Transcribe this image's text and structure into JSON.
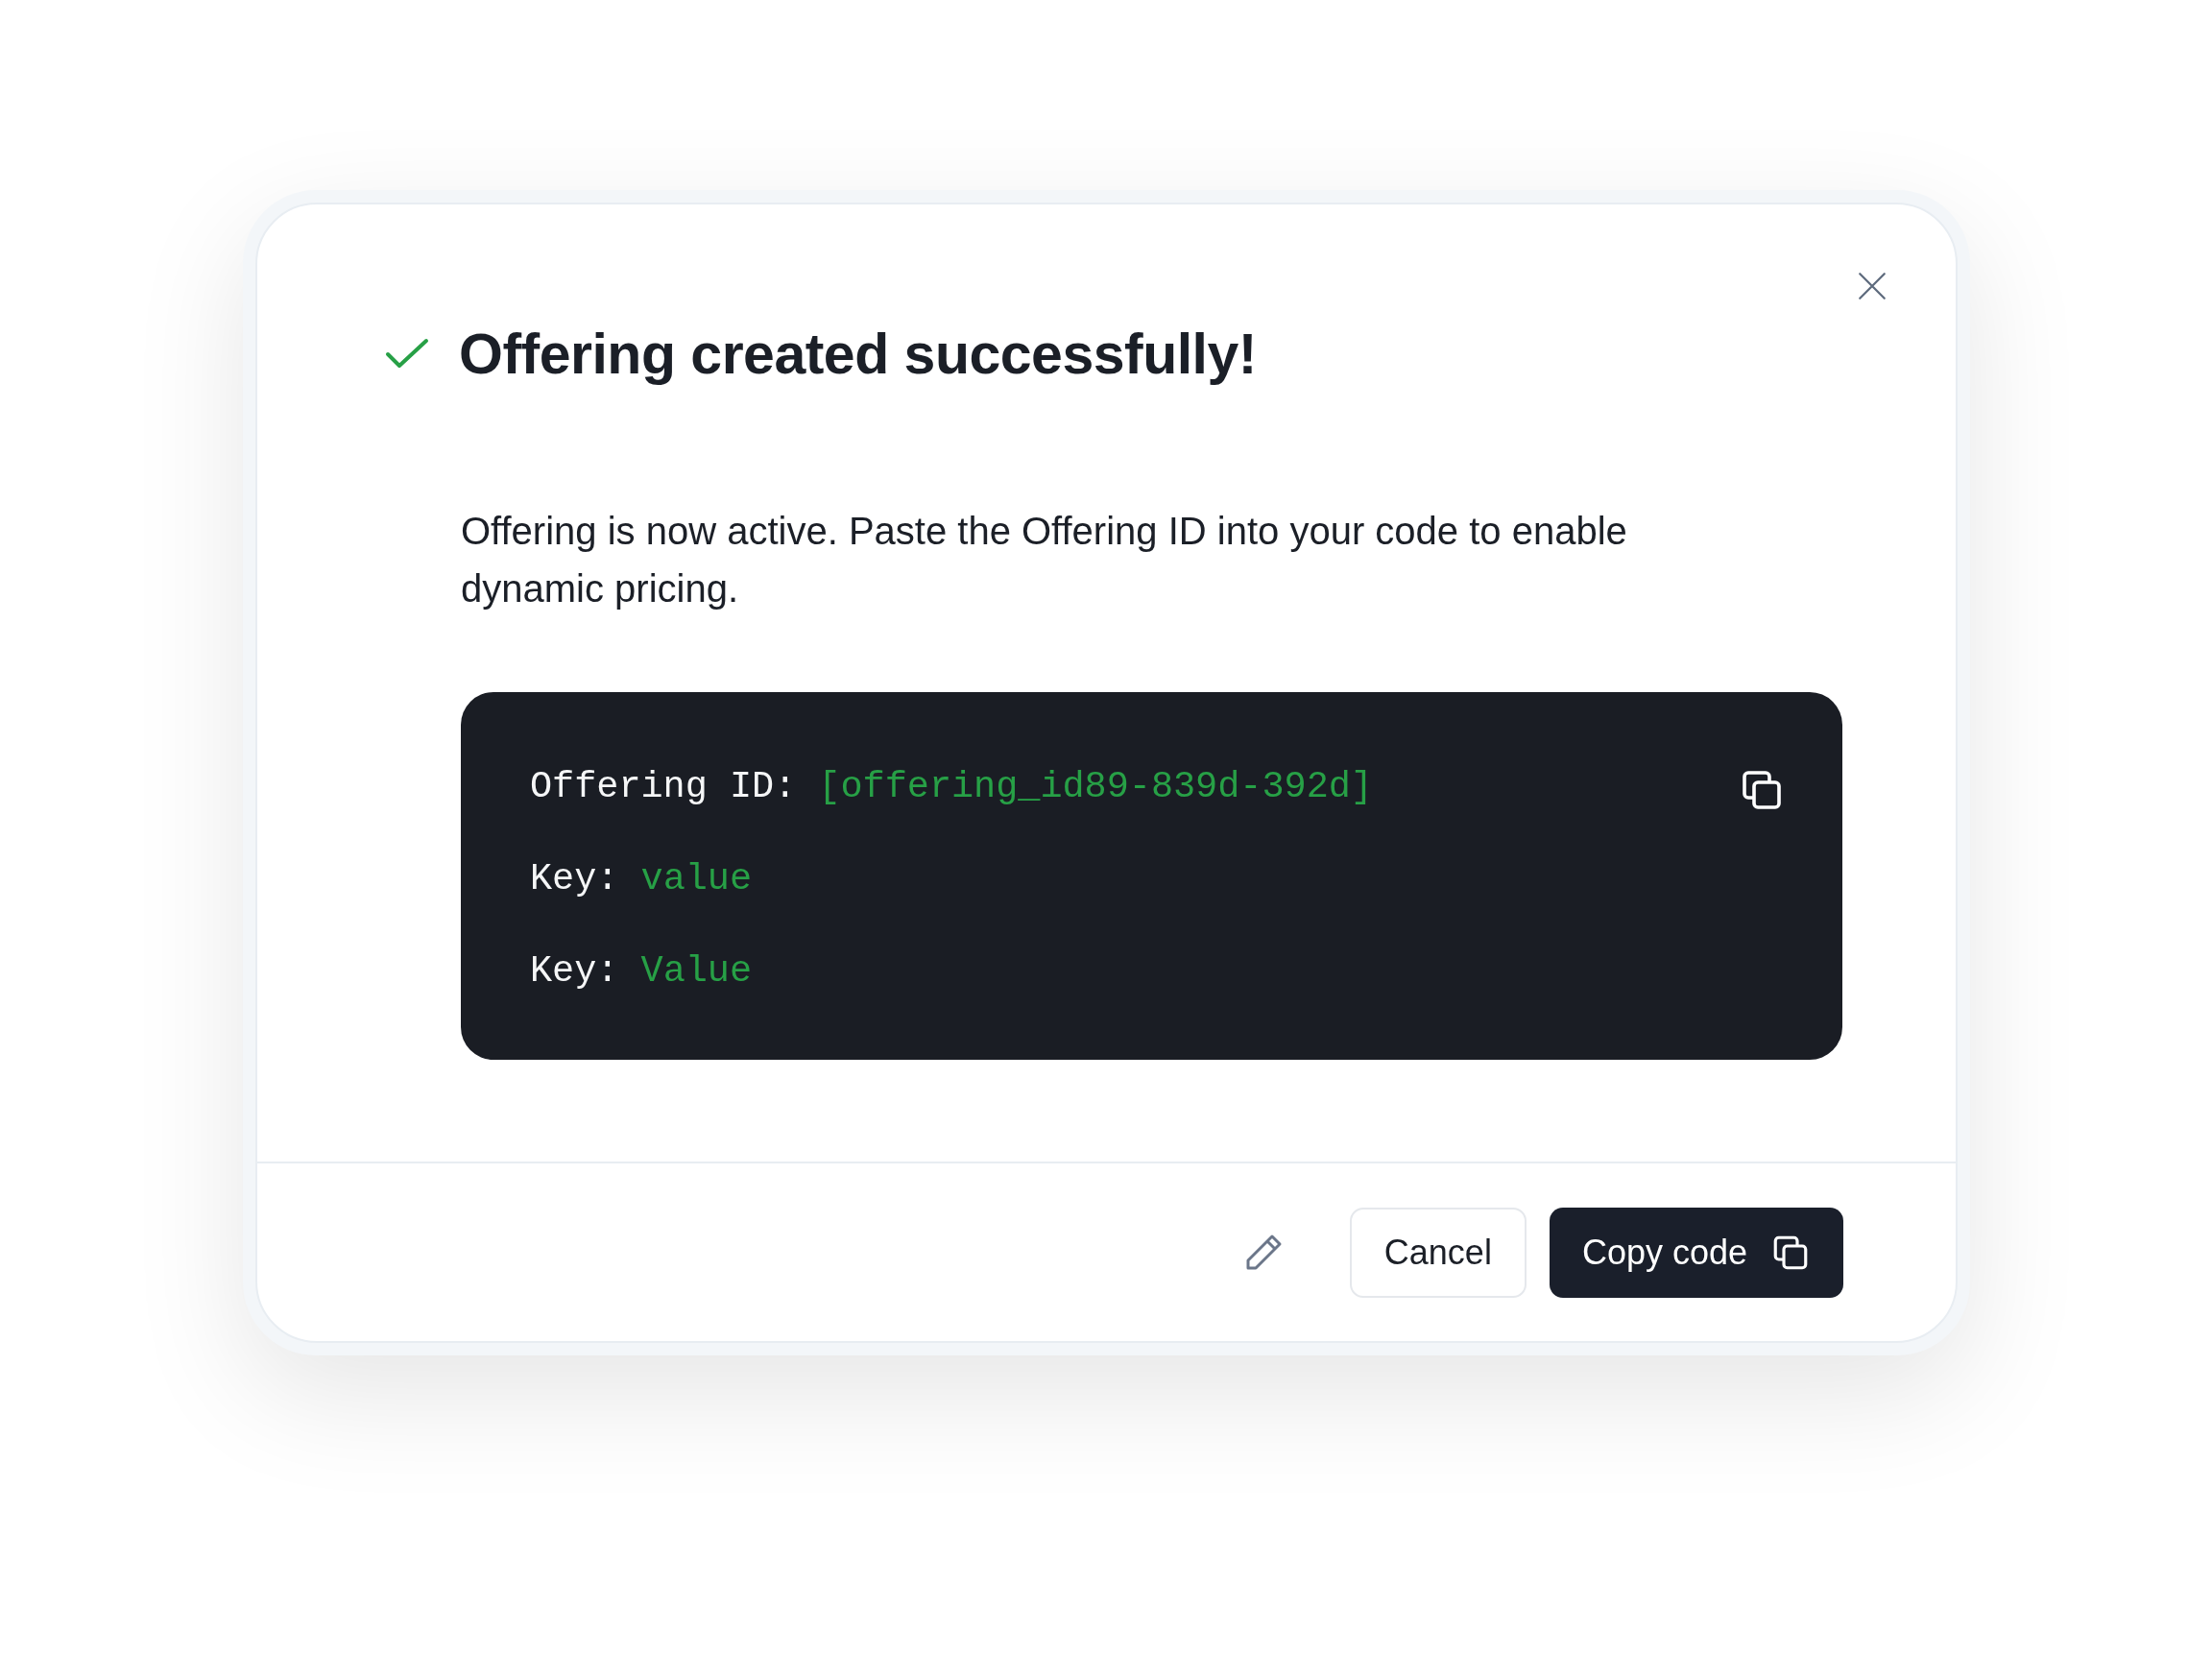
{
  "dialog": {
    "title": "Offering created successfully!",
    "message": "Offering is now active. Paste the Offering ID into your code to enable dynamic pricing.",
    "code_lines": [
      {
        "key": "Offering ID:",
        "value": "[offering_id89-839d-392d]"
      },
      {
        "key": "Key:",
        "value": "value"
      },
      {
        "key": "Key:",
        "value": "Value"
      }
    ],
    "buttons": [
      {
        "label": "Cancel",
        "kind": "secondary"
      },
      {
        "label": "Copy code",
        "kind": "primary"
      }
    ]
  }
}
